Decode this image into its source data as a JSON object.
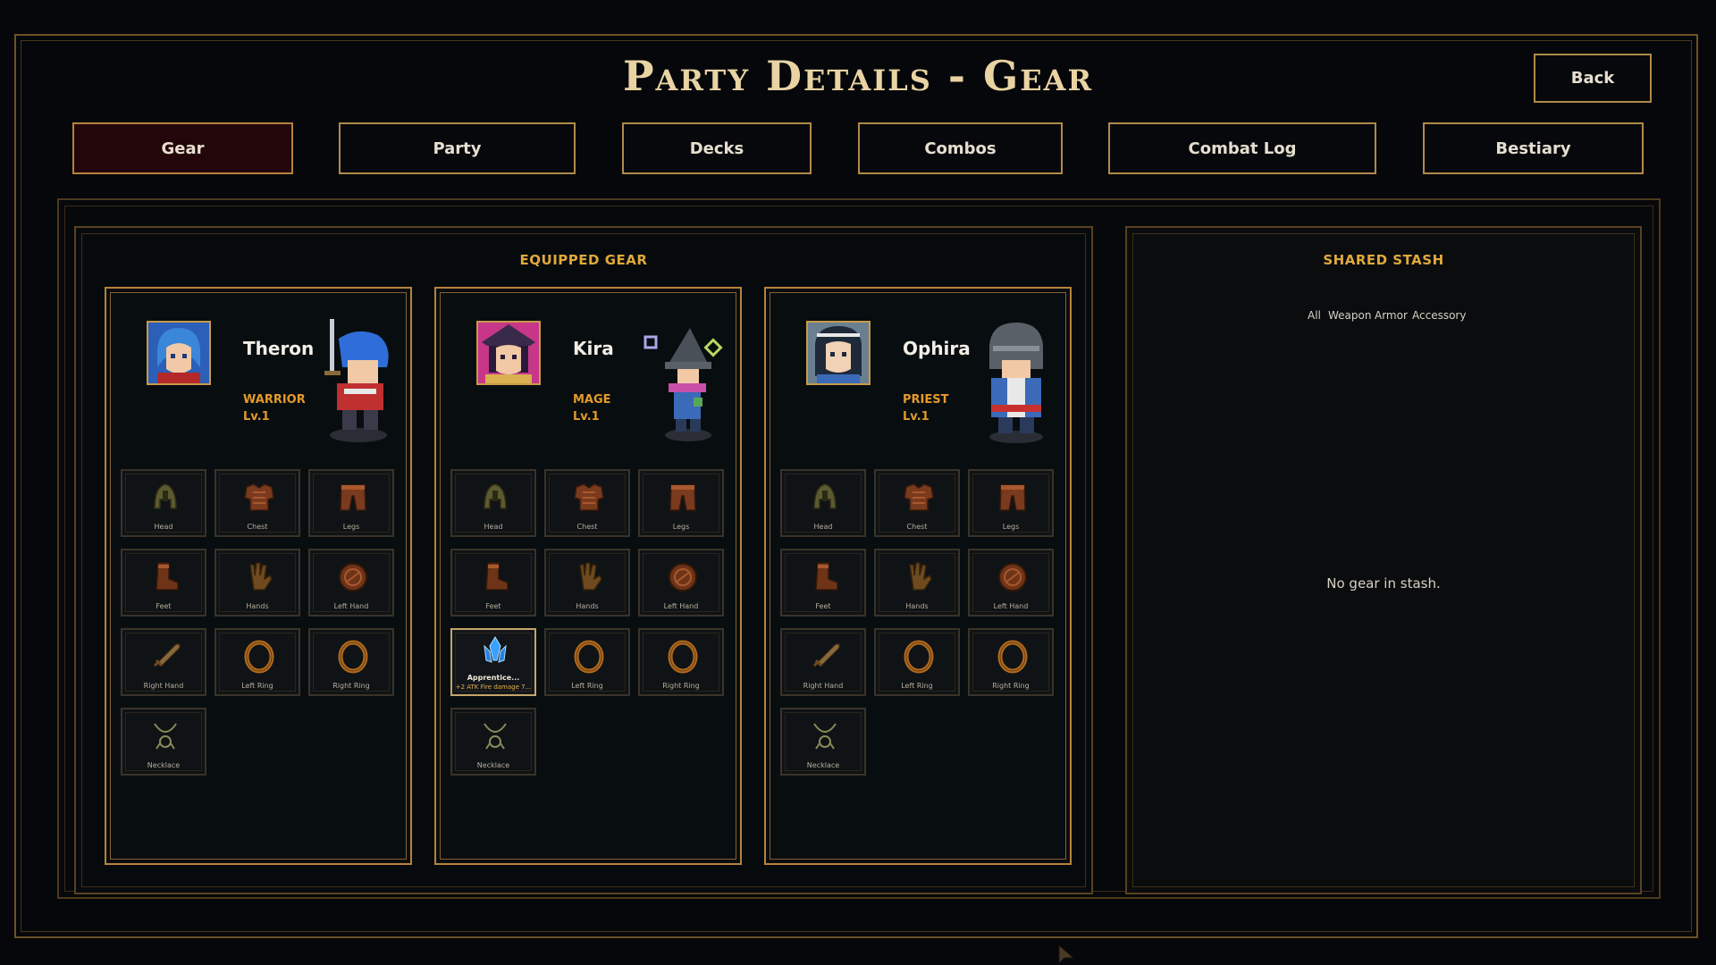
{
  "title": "Party Details - Gear",
  "back_label": "Back",
  "tabs": [
    {
      "label": "Gear",
      "active": true
    },
    {
      "label": "Party",
      "active": false
    },
    {
      "label": "Decks",
      "active": false
    },
    {
      "label": "Combos",
      "active": false
    },
    {
      "label": "Combat Log",
      "active": false
    },
    {
      "label": "Bestiary",
      "active": false
    }
  ],
  "equipped_title": "EQUIPPED GEAR",
  "characters": [
    {
      "name": "Theron",
      "class": "WARRIOR",
      "level": "Lv.1",
      "slots": [
        "Head",
        "Chest",
        "Legs",
        "Feet",
        "Hands",
        "Left Hand",
        "Right Hand",
        "Left Ring",
        "Right Ring",
        "Necklace"
      ]
    },
    {
      "name": "Kira",
      "class": "MAGE",
      "level": "Lv.1",
      "slots": [
        "Head",
        "Chest",
        "Legs",
        "Feet",
        "Hands",
        "Left Hand",
        "Right Hand",
        "Left Ring",
        "Right Ring",
        "Necklace"
      ],
      "equipped_item": {
        "slot": "Right Hand",
        "name": "Apprentice...",
        "desc": "+2 ATK Fire damage 7..."
      }
    },
    {
      "name": "Ophira",
      "class": "PRIEST",
      "level": "Lv.1",
      "slots": [
        "Head",
        "Chest",
        "Legs",
        "Feet",
        "Hands",
        "Left Hand",
        "Right Hand",
        "Left Ring",
        "Right Ring",
        "Necklace"
      ]
    }
  ],
  "stash": {
    "title": "SHARED STASH",
    "filters": [
      "All",
      "Weapon",
      "Armor",
      "Accessory"
    ],
    "empty_text": "No gear in stash."
  },
  "icons": [
    "helmet-icon",
    "chest-armor-icon",
    "leg-armor-icon",
    "boot-icon",
    "gauntlet-icon",
    "shield-icon",
    "sword-icon",
    "ring-icon",
    "ring-icon",
    "necklace-icon"
  ],
  "colors": {
    "accent": "#e0a93c",
    "border": "#b8823c",
    "active_tab": "#230609"
  }
}
